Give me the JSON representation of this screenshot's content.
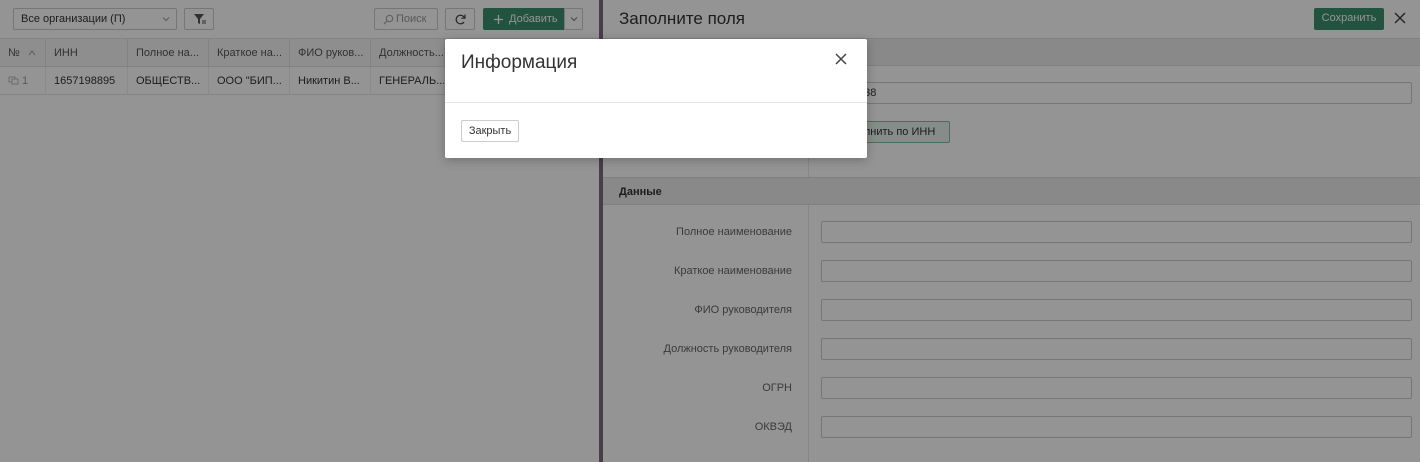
{
  "left_panel": {
    "org_select": {
      "value": "Все организации (П)"
    },
    "search": {
      "label": "Поиск"
    },
    "add": {
      "label": "Добавить"
    },
    "columns": [
      "№",
      "ИНН",
      "Полное на...",
      "Краткое на...",
      "ФИО руков...",
      "Должность..."
    ],
    "rows": [
      {
        "num": "1",
        "inn": "1657198895",
        "full_name": "ОБЩЕСТВ...",
        "short_name": "ООО \"БИП...",
        "director": "Никитин В...",
        "position": "ГЕНЕРАЛЬ..."
      }
    ]
  },
  "right_panel": {
    "title": "Заполните поля",
    "save_label": "Сохранить",
    "inn_value": "838",
    "fill_by_inn_label": "олнить по ИНН",
    "data_section_title": "Данные",
    "fields": [
      {
        "label": "Полное наименование",
        "value": ""
      },
      {
        "label": "Краткое наименование",
        "value": ""
      },
      {
        "label": "ФИО руководителя",
        "value": ""
      },
      {
        "label": "Должность руководителя",
        "value": ""
      },
      {
        "label": "ОГРН",
        "value": ""
      },
      {
        "label": "ОКВЭД",
        "value": ""
      }
    ]
  },
  "modal": {
    "title": "Информация",
    "close_button_label": "Закрыть"
  },
  "colors": {
    "accent": "#3a8f6f",
    "divider": "#7e6a7a",
    "overlay": "rgba(0,0,0,0.42)"
  },
  "icons": [
    "chevron-down-icon",
    "filter-icon",
    "search-icon",
    "refresh-icon",
    "plus-icon",
    "sort-icon",
    "copy-icon",
    "close-icon"
  ]
}
